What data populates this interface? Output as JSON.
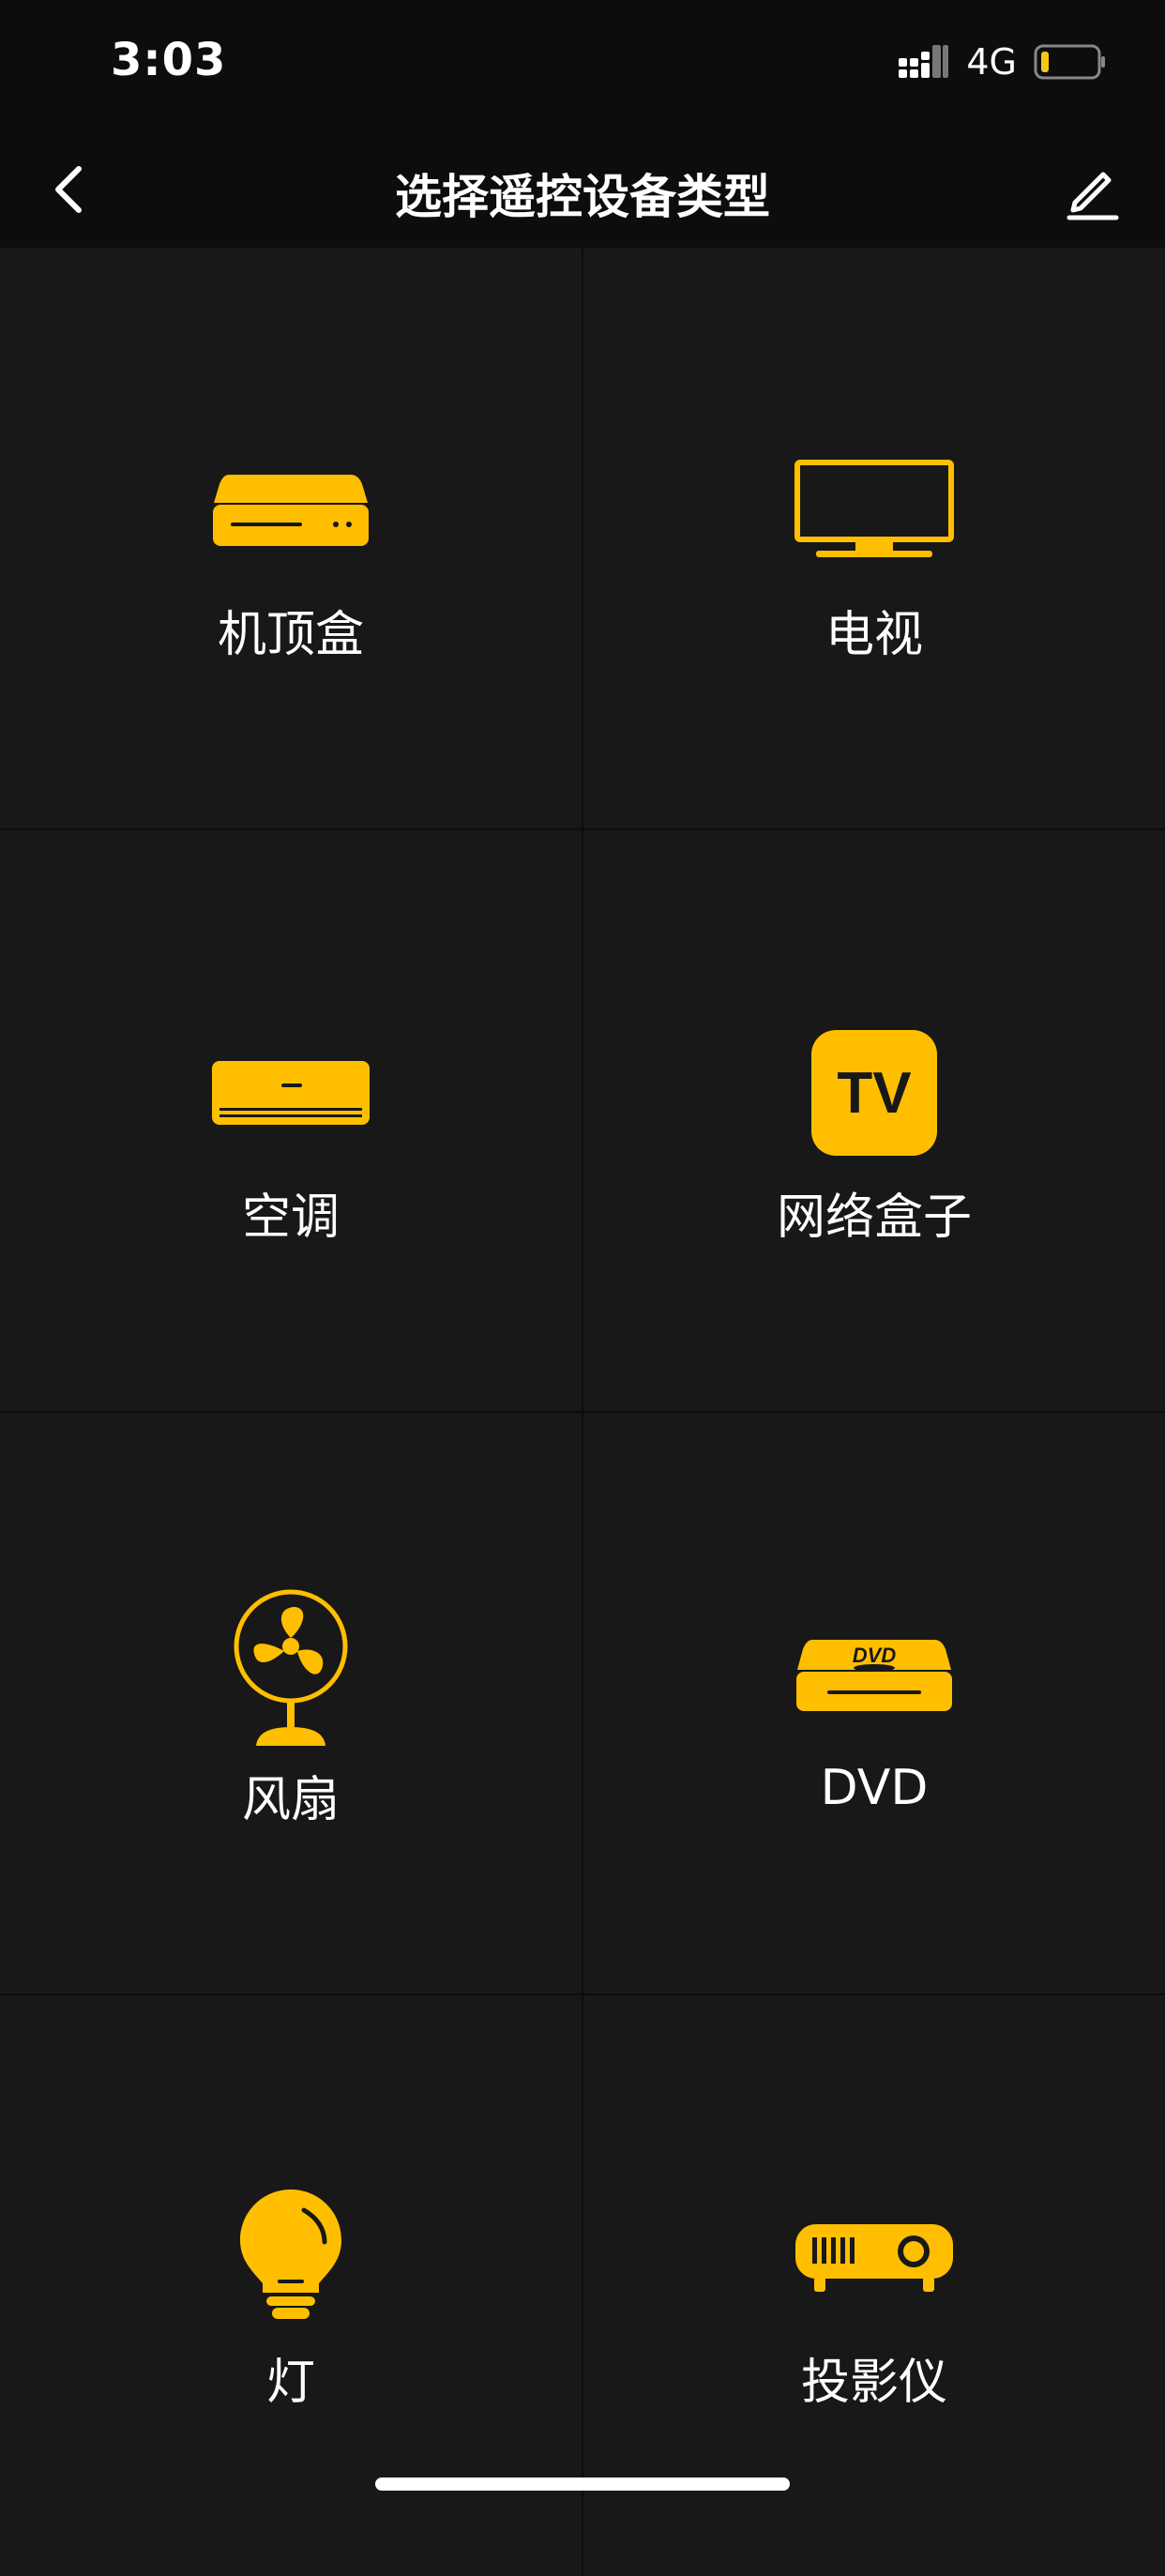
{
  "status_bar": {
    "time": "3:03",
    "network": "4G",
    "battery_color": "#f5c518"
  },
  "nav": {
    "title": "选择遥控设备类型",
    "back_icon": "chevron-left-icon",
    "edit_icon": "pencil-icon"
  },
  "accent_color": "#ffbf00",
  "devices": [
    {
      "label": "机顶盒",
      "icon": "set-top-box-icon"
    },
    {
      "label": "电视",
      "icon": "tv-icon"
    },
    {
      "label": "空调",
      "icon": "air-conditioner-icon"
    },
    {
      "label": "网络盒子",
      "icon": "network-box-icon",
      "icon_text": "TV"
    },
    {
      "label": "风扇",
      "icon": "fan-icon"
    },
    {
      "label": "DVD",
      "icon": "dvd-player-icon",
      "icon_text": "DVD"
    },
    {
      "label": "灯",
      "icon": "light-bulb-icon"
    },
    {
      "label": "投影仪",
      "icon": "projector-icon"
    }
  ]
}
